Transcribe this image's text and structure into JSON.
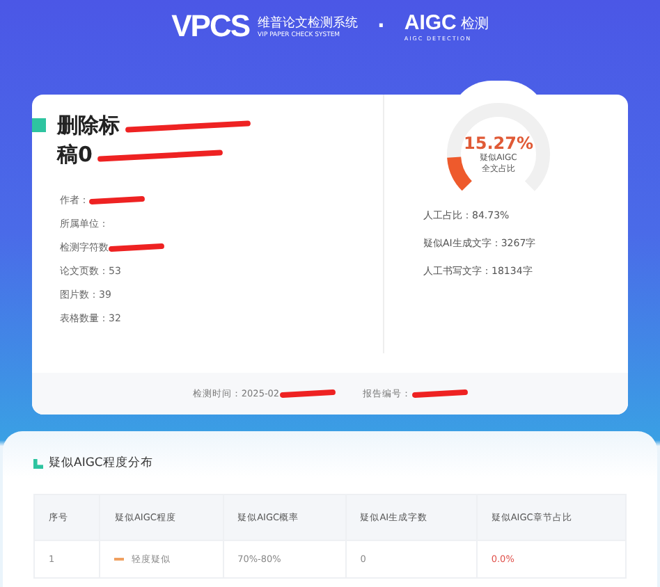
{
  "header": {
    "logo": "VPCS",
    "brand_cn": "维普论文检测系统",
    "brand_en": "VIP PAPER CHECK SYSTEM",
    "separator": "·",
    "aigc_logo": "AIGC",
    "aigc_title": "检测",
    "aigc_en": "AIGC DETECTION"
  },
  "report": {
    "title_lines": [
      "删除标",
      "稿0"
    ],
    "fields": [
      {
        "label": "作者：",
        "redacted": true
      },
      {
        "label": "所属单位：",
        "redacted": false
      },
      {
        "label": "检测字符数",
        "redacted": true
      },
      {
        "label": "论文页数：",
        "value": "53",
        "redacted": false
      },
      {
        "label": "图片数：",
        "value": "39",
        "redacted": false
      },
      {
        "label": "表格数量：",
        "value": "32",
        "redacted": false
      }
    ],
    "gauge": {
      "percent": "15.27%",
      "caption_lines": [
        "疑似AIGC",
        "全文占比"
      ],
      "level": 0.1527
    },
    "stats": [
      "人工占比：84.73%",
      "疑似AI生成文字：3267字",
      "人工书写文字：18134字"
    ],
    "footer": [
      {
        "label": "检测时间：",
        "value": "2025-02",
        "redacted": true
      },
      {
        "label": "报告编号：",
        "redacted": true
      }
    ]
  },
  "distribution": {
    "title": "疑似AIGC程度分布",
    "table": {
      "columns": [
        "序号",
        "疑似AIGC程度",
        "疑似AIGC概率",
        "疑似AI生成字数",
        "疑似AIGC章节占比"
      ],
      "rows": [
        {
          "cells": [
            "1",
            "轻度疑似",
            "70%-80%",
            "0",
            "0.0%"
          ],
          "color": "#f0a060"
        }
      ]
    }
  }
}
